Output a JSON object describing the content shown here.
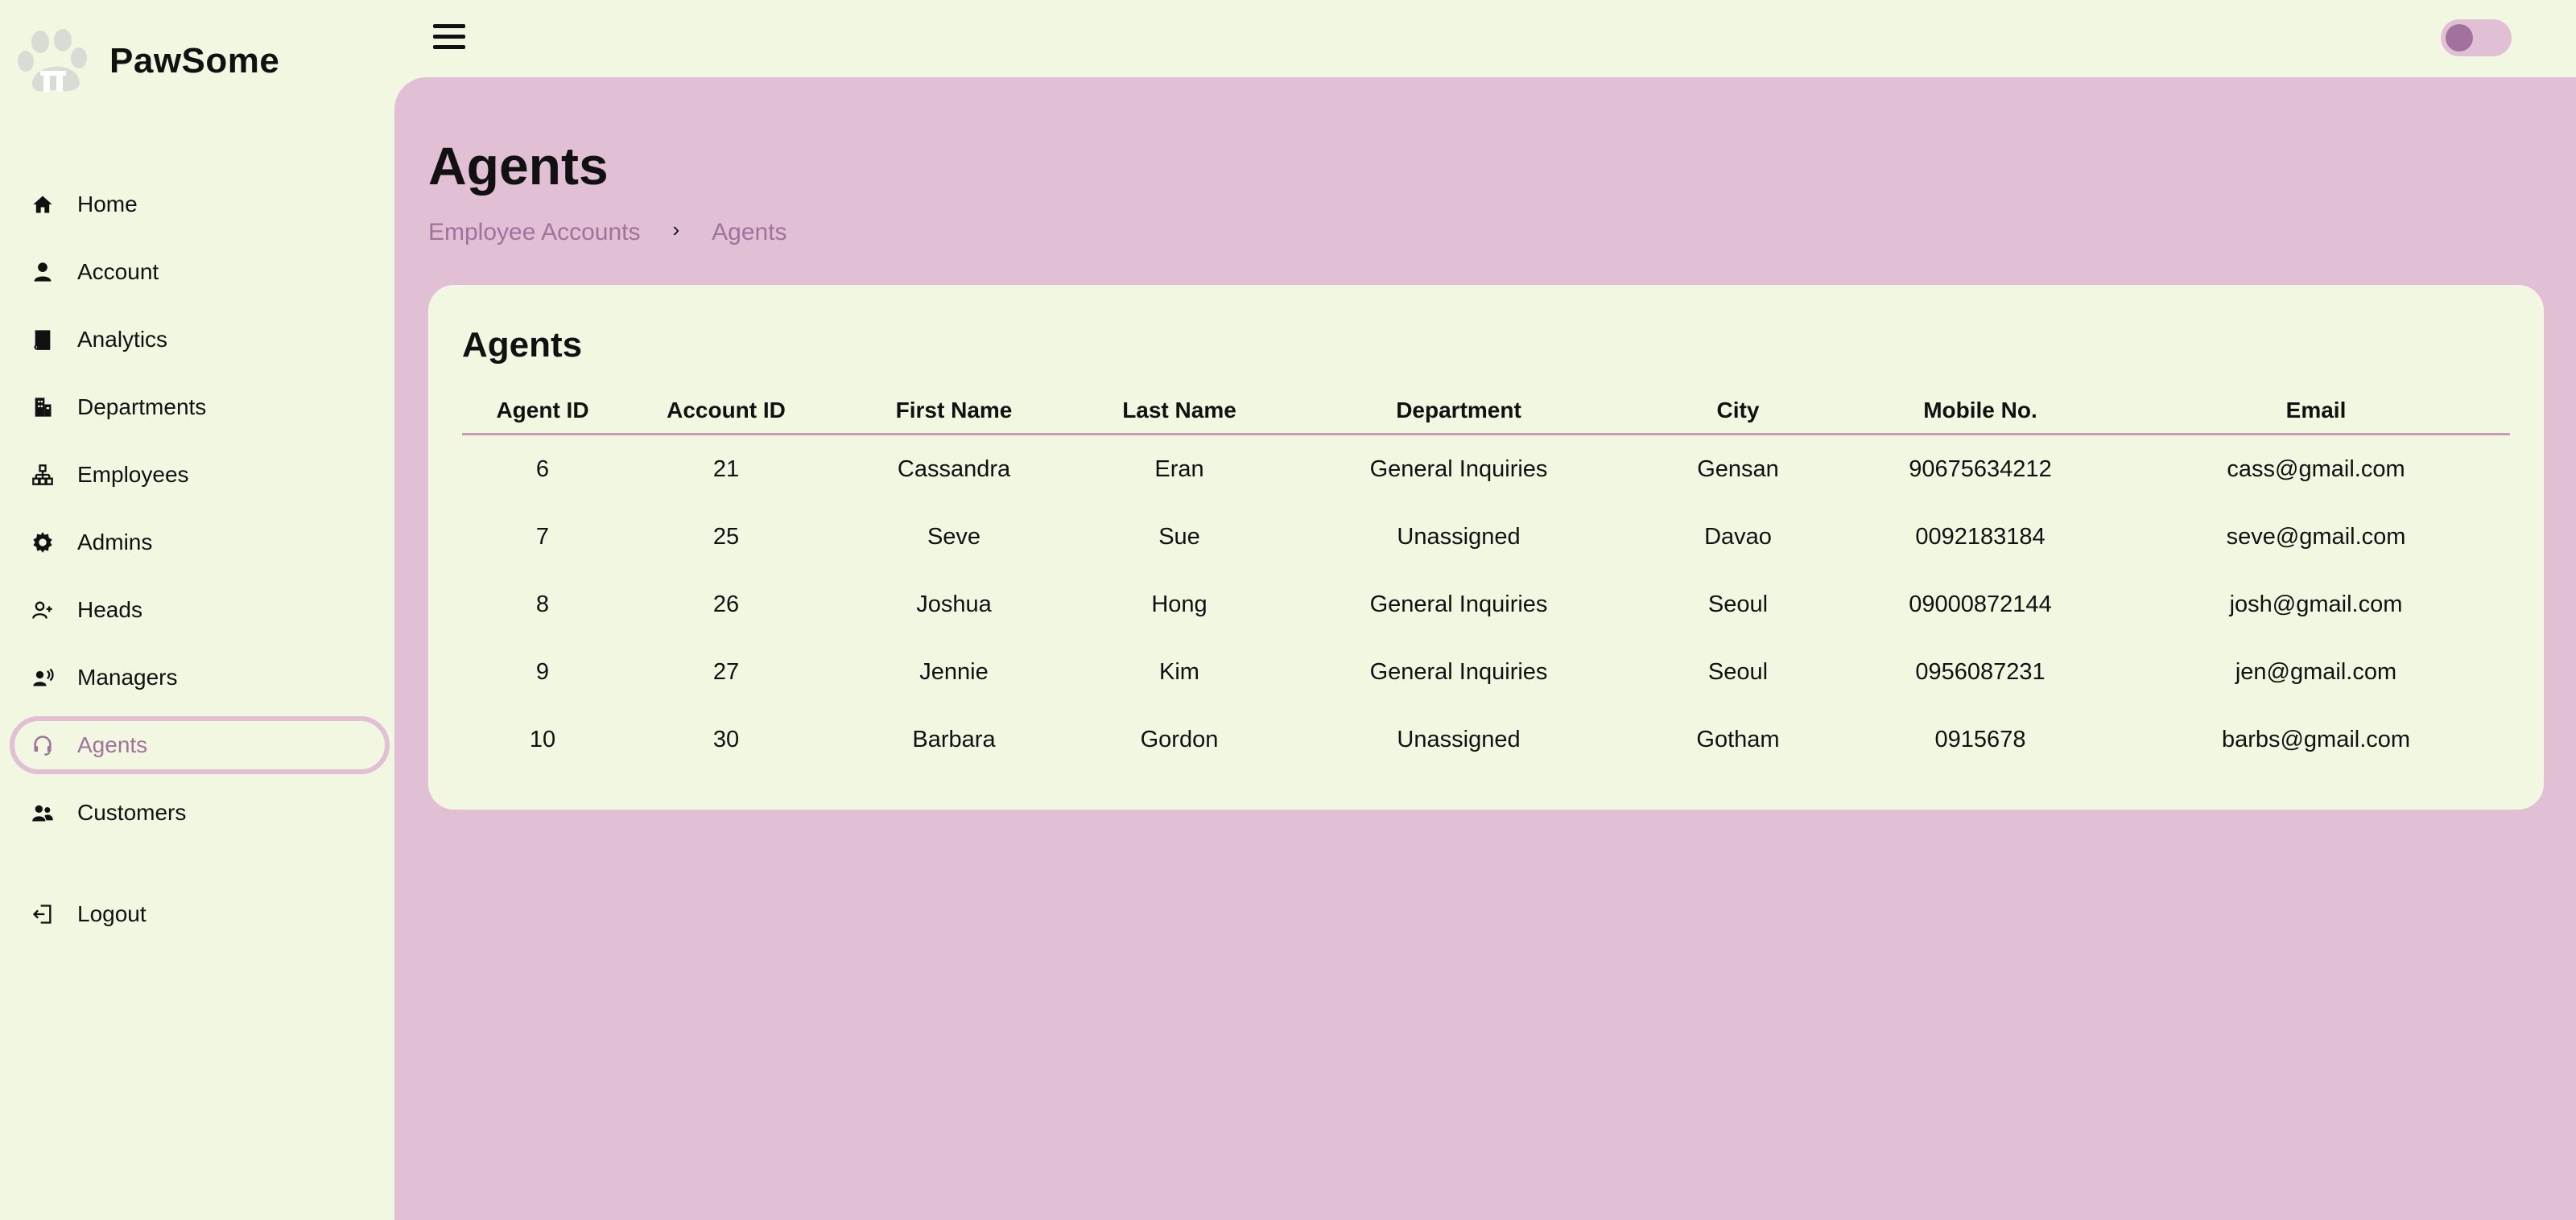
{
  "app": {
    "name": "PawSome"
  },
  "sidebar": {
    "items": [
      {
        "label": "Home",
        "icon": "home-icon"
      },
      {
        "label": "Account",
        "icon": "person-icon"
      },
      {
        "label": "Analytics",
        "icon": "book-icon"
      },
      {
        "label": "Departments",
        "icon": "building-icon"
      },
      {
        "label": "Employees",
        "icon": "org-chart-icon"
      },
      {
        "label": "Admins",
        "icon": "gear-icon"
      },
      {
        "label": "Heads",
        "icon": "person-add-icon"
      },
      {
        "label": "Managers",
        "icon": "person-voice-icon"
      },
      {
        "label": "Agents",
        "icon": "headset-icon",
        "active": true
      },
      {
        "label": "Customers",
        "icon": "people-icon"
      }
    ],
    "logout": {
      "label": "Logout",
      "icon": "logout-icon"
    }
  },
  "colors": {
    "background": "#f2f7e2",
    "main_panel": "#e1bfd4",
    "accent": "#a0729c",
    "divider": "#c99bbb"
  },
  "page": {
    "title": "Agents",
    "breadcrumb": [
      "Employee Accounts",
      "Agents"
    ]
  },
  "card": {
    "title": "Agents",
    "columns": [
      "Agent ID",
      "Account ID",
      "First Name",
      "Last Name",
      "Department",
      "City",
      "Mobile No.",
      "Email"
    ],
    "rows": [
      [
        "6",
        "21",
        "Cassandra",
        "Eran",
        "General Inquiries",
        "Gensan",
        "90675634212",
        "cass@gmail.com"
      ],
      [
        "7",
        "25",
        "Seve",
        "Sue",
        "Unassigned",
        "Davao",
        "0092183184",
        "seve@gmail.com"
      ],
      [
        "8",
        "26",
        "Joshua",
        "Hong",
        "General Inquiries",
        "Seoul",
        "09000872144",
        "josh@gmail.com"
      ],
      [
        "9",
        "27",
        "Jennie",
        "Kim",
        "General Inquiries",
        "Seoul",
        "0956087231",
        "jen@gmail.com"
      ],
      [
        "10",
        "30",
        "Barbara",
        "Gordon",
        "Unassigned",
        "Gotham",
        "0915678",
        "barbs@gmail.com"
      ]
    ]
  }
}
